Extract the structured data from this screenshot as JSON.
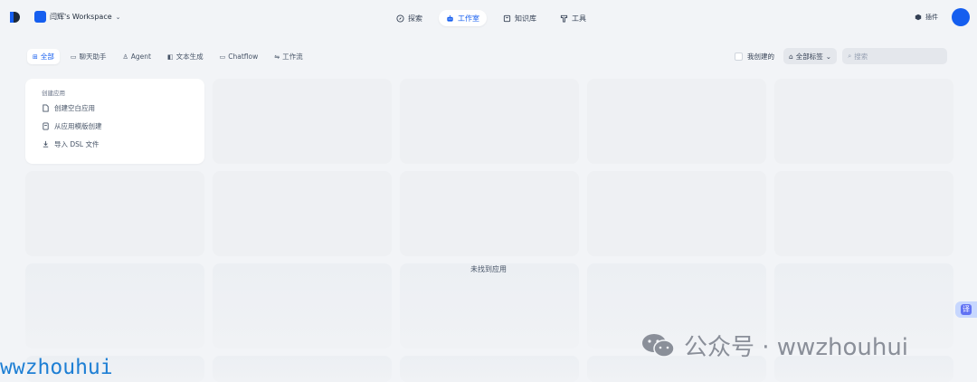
{
  "workspace": {
    "name": "闫辉's Workspace"
  },
  "nav": [
    {
      "label": "探索",
      "icon": "compass-icon",
      "active": false
    },
    {
      "label": "工作室",
      "icon": "robot-icon",
      "active": true
    },
    {
      "label": "知识库",
      "icon": "book-icon",
      "active": false
    },
    {
      "label": "工具",
      "icon": "tool-icon",
      "active": false
    }
  ],
  "plugin": {
    "label": "插件",
    "icon": "cube-icon"
  },
  "tabs": [
    {
      "label": "全部",
      "icon": "grid-icon",
      "active": true
    },
    {
      "label": "聊天助手",
      "icon": "chat-icon",
      "active": false
    },
    {
      "label": "Agent",
      "icon": "agent-icon",
      "active": false
    },
    {
      "label": "文本生成",
      "icon": "text-icon",
      "active": false
    },
    {
      "label": "Chatflow",
      "icon": "chatflow-icon",
      "active": false
    },
    {
      "label": "工作流",
      "icon": "workflow-icon",
      "active": false
    }
  ],
  "filters": {
    "mine_label": "我创建的",
    "tag_label": "全部标签",
    "search_placeholder": "搜索"
  },
  "create": {
    "title": "创建应用",
    "items": [
      {
        "label": "创建空白应用",
        "icon": "file-plus-icon"
      },
      {
        "label": "从应用模版创建",
        "icon": "template-icon"
      },
      {
        "label": "导入 DSL 文件",
        "icon": "import-icon"
      }
    ]
  },
  "empty_message": "未找到应用",
  "translate_label": "译",
  "watermark": {
    "text": "公众号 · wwzhouhui"
  },
  "corner_watermark": "wwzhouhui",
  "colors": {
    "accent": "#155eef",
    "background": "#f2f4f7"
  }
}
